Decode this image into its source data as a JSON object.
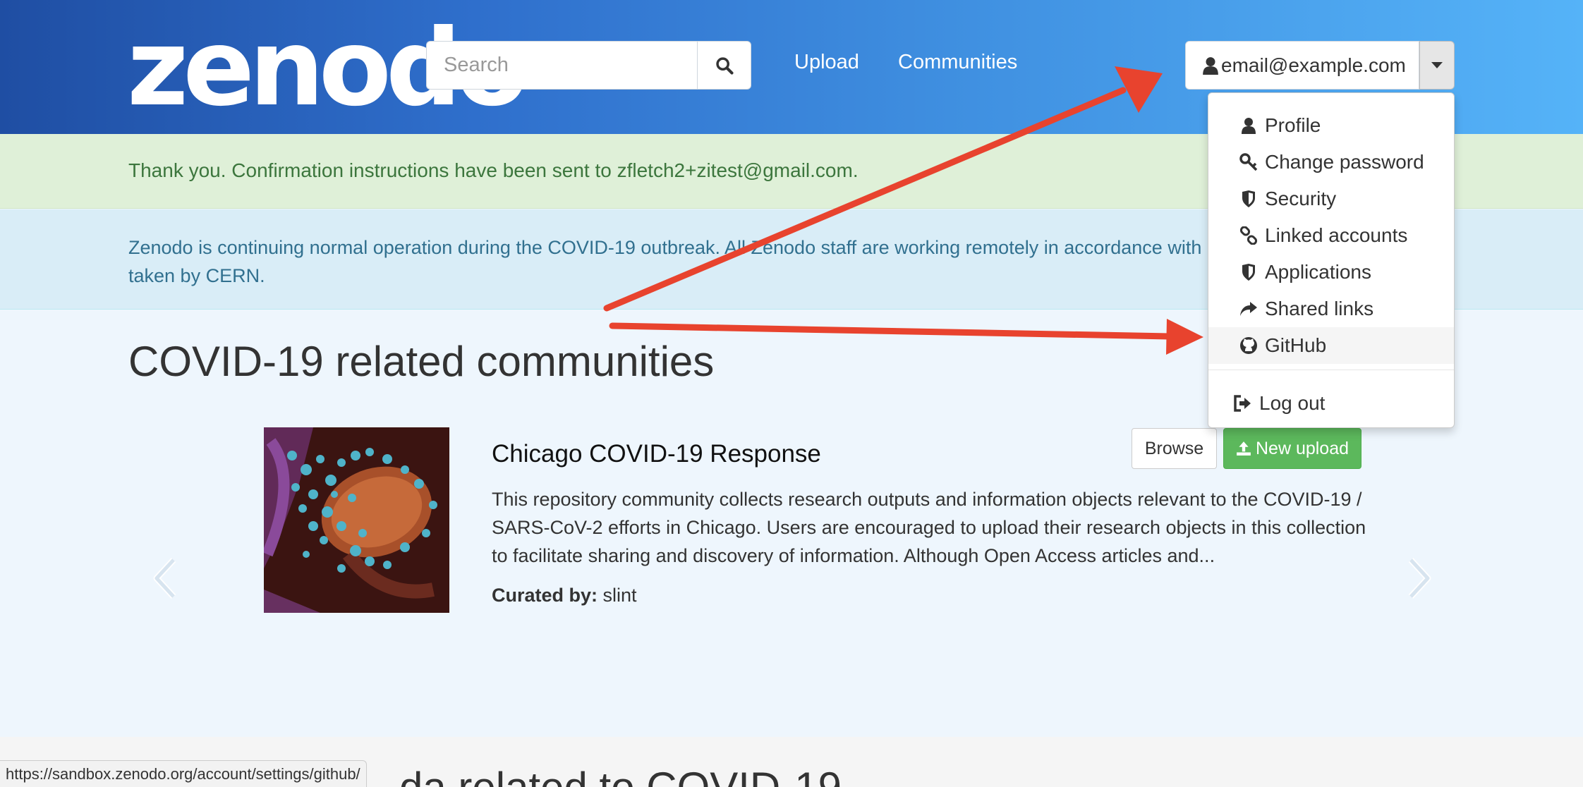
{
  "header": {
    "logo": "zenodo",
    "search_placeholder": "Search",
    "nav": [
      "Upload",
      "Communities"
    ],
    "user_email": "email@example.com"
  },
  "user_menu": {
    "items": [
      {
        "label": "Profile",
        "icon": "user-icon"
      },
      {
        "label": "Change password",
        "icon": "key-icon"
      },
      {
        "label": "Security",
        "icon": "shield-icon"
      },
      {
        "label": "Linked accounts",
        "icon": "link-icon"
      },
      {
        "label": "Applications",
        "icon": "shield-icon"
      },
      {
        "label": "Shared links",
        "icon": "share-icon"
      },
      {
        "label": "GitHub",
        "icon": "github-icon"
      }
    ],
    "logout": "Log out"
  },
  "alerts": {
    "success": "Thank you. Confirmation instructions have been sent to zfletch2+zitest@gmail.com.",
    "info": "Zenodo is continuing normal operation during the COVID-19 outbreak. All Zenodo staff are working remotely in accordance with taken by CERN."
  },
  "communities": {
    "title": "COVID-19 related communities",
    "item": {
      "title": "Chicago COVID-19 Response",
      "browse": "Browse",
      "new_upload": "New upload",
      "description": "This repository community collects research outputs and information objects relevant to the COVID-19 / SARS-CoV-2 efforts in Chicago. Users are encouraged to upload their research objects in this collection to facilitate sharing and discovery of information. Although Open Access articles and...",
      "curated_label": "Curated by:",
      "curated_by": "slint"
    }
  },
  "lower_section": {
    "title_partial": "da related to COVID-19"
  },
  "status_url": "https://sandbox.zenodo.org/account/settings/github/",
  "colors": {
    "header_start": "#1f4ea3",
    "header_end": "#55b3f8",
    "success_bg": "#dff0d8",
    "info_bg": "#d9edf7",
    "upload_green": "#5cb85c",
    "annotation_red": "#e8432e"
  }
}
